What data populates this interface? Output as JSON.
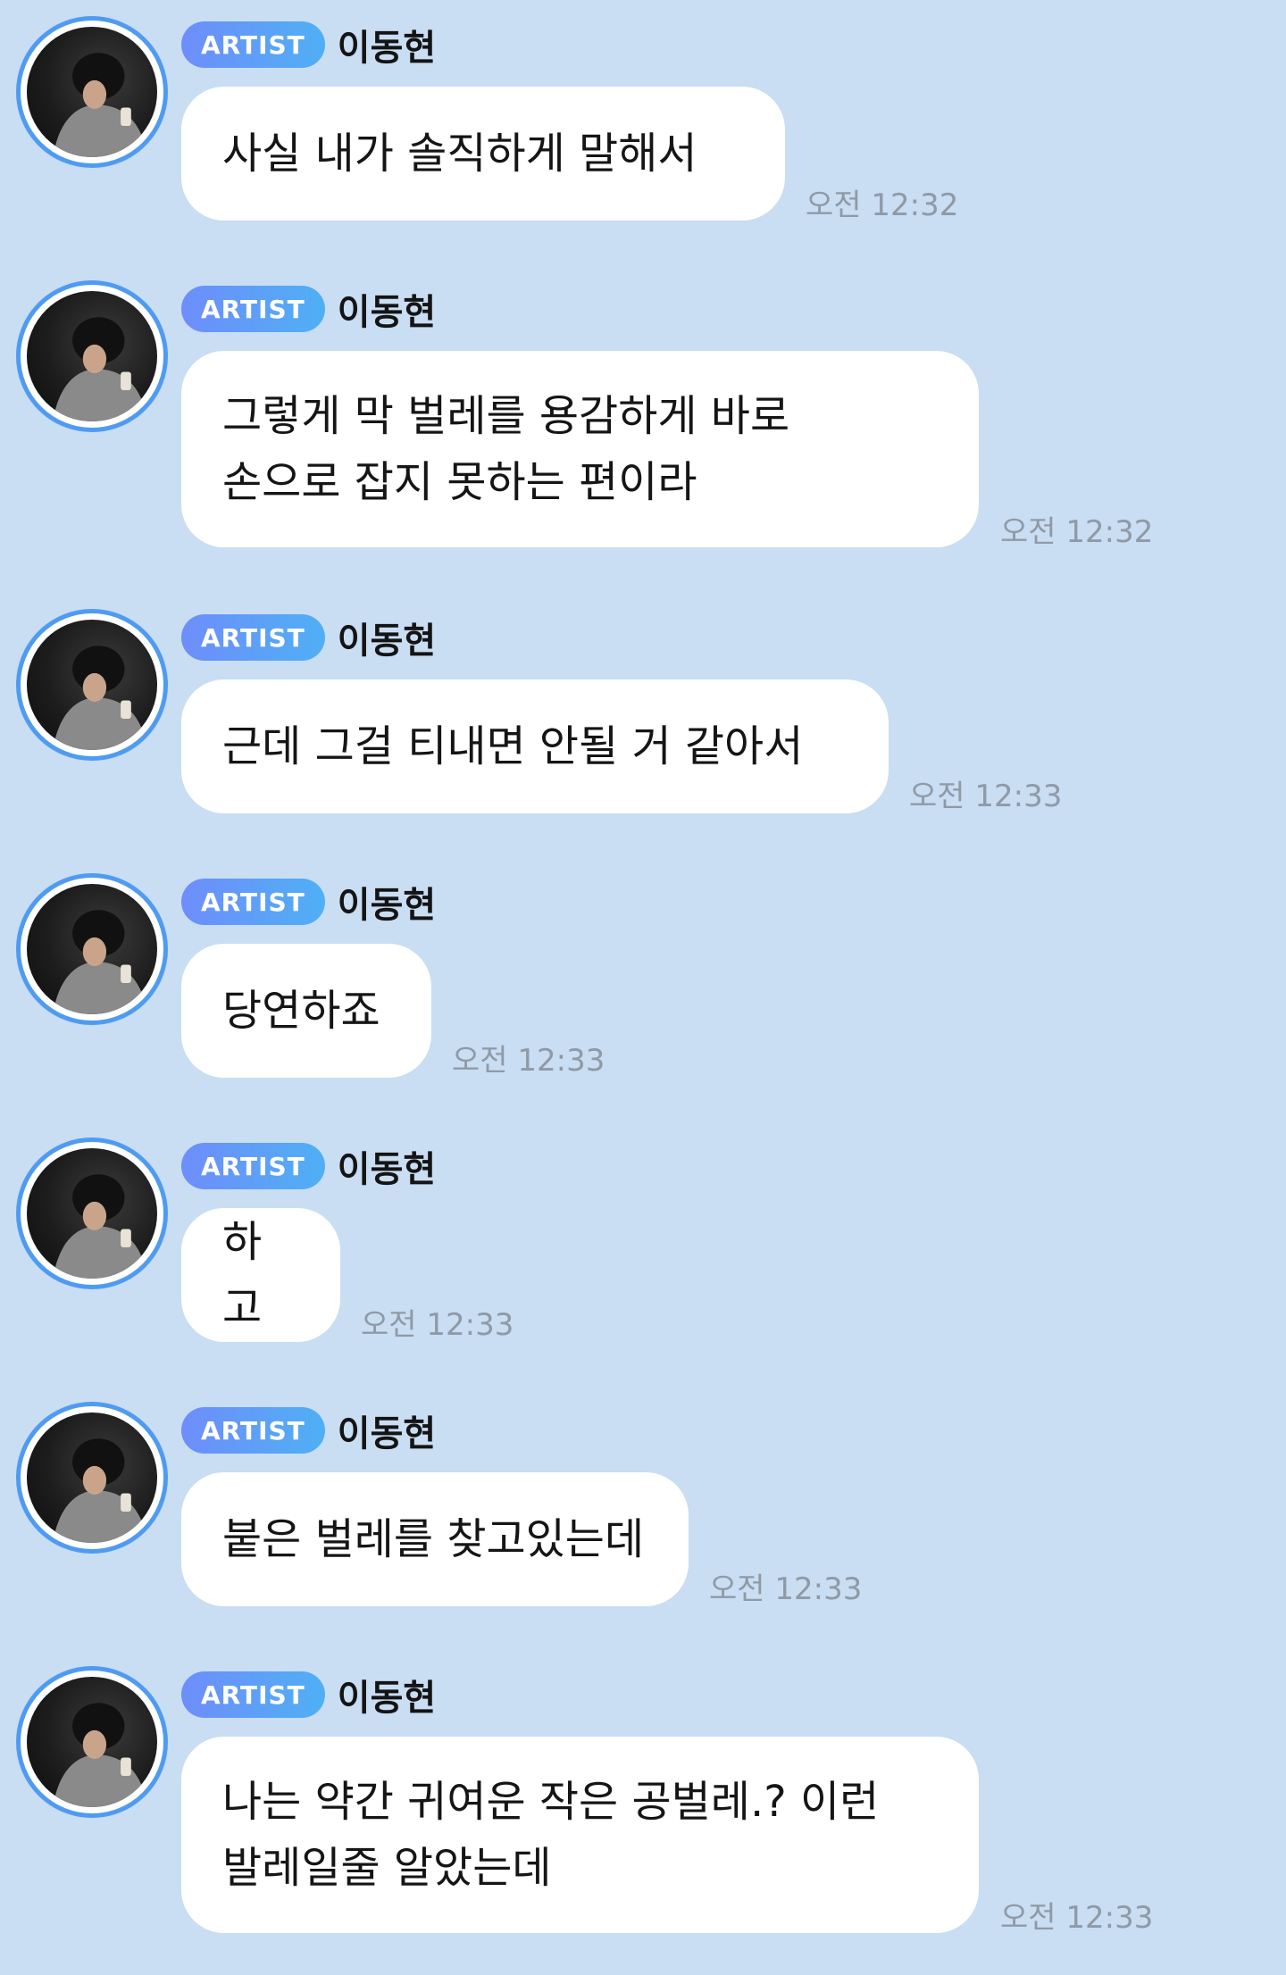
{
  "messages": [
    {
      "badge": "ARTIST",
      "name": "이동현",
      "text": "사실 내가 솔직하게 말해서",
      "time": "오전 12:32",
      "avatar_icon": "profile-photo"
    },
    {
      "badge": "ARTIST",
      "name": "이동현",
      "text": "그렇게 막 벌레를 용감하게 바로\n손으로 잡지 못하는 편이라",
      "time": "오전 12:32",
      "avatar_icon": "profile-photo"
    },
    {
      "badge": "ARTIST",
      "name": "이동현",
      "text": "근데 그걸 티내면 안될 거 같아서",
      "time": "오전 12:33",
      "avatar_icon": "profile-photo"
    },
    {
      "badge": "ARTIST",
      "name": "이동현",
      "text": "당연하죠",
      "time": "오전 12:33",
      "avatar_icon": "profile-photo"
    },
    {
      "badge": "ARTIST",
      "name": "이동현",
      "text": "하고",
      "time": "오전 12:33",
      "avatar_icon": "profile-photo"
    },
    {
      "badge": "ARTIST",
      "name": "이동현",
      "text": "붙은 벌레를 찾고있는데",
      "time": "오전 12:33",
      "avatar_icon": "profile-photo"
    },
    {
      "badge": "ARTIST",
      "name": "이동현",
      "text": "나는 약간 귀여운 작은 공벌레.? 이런\n발레일줄 알았는데",
      "time": "오전 12:33",
      "avatar_icon": "profile-photo"
    }
  ],
  "colors": {
    "background": "#c9ddf3",
    "bubble": "#ffffff",
    "avatar_ring": "#4f9bf2",
    "badge_start": "#6e8dfb",
    "badge_end": "#4fb0f4",
    "timestamp": "#8f9aa6"
  }
}
